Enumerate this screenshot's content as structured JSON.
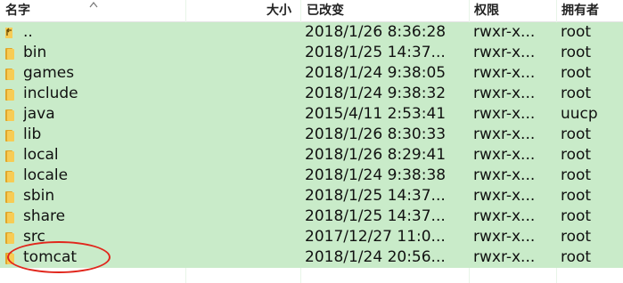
{
  "columns": {
    "name": "名字",
    "size": "大小",
    "modified": "已改变",
    "permissions": "权限",
    "owner": "拥有者"
  },
  "rows": [
    {
      "name": "..",
      "size": "",
      "modified": "2018/1/26 8:36:28",
      "permissions": "rwxr-x...",
      "owner": "root",
      "icon": "up-folder-icon"
    },
    {
      "name": "bin",
      "size": "",
      "modified": "2018/1/25 14:37...",
      "permissions": "rwxr-x...",
      "owner": "root",
      "icon": "folder-icon"
    },
    {
      "name": "games",
      "size": "",
      "modified": "2018/1/24 9:38:05",
      "permissions": "rwxr-x...",
      "owner": "root",
      "icon": "folder-icon"
    },
    {
      "name": "include",
      "size": "",
      "modified": "2018/1/24 9:38:32",
      "permissions": "rwxr-x...",
      "owner": "root",
      "icon": "folder-icon"
    },
    {
      "name": "java",
      "size": "",
      "modified": "2015/4/11 2:53:41",
      "permissions": "rwxr-x...",
      "owner": "uucp",
      "icon": "folder-icon"
    },
    {
      "name": "lib",
      "size": "",
      "modified": "2018/1/26 8:30:33",
      "permissions": "rwxr-x...",
      "owner": "root",
      "icon": "folder-icon"
    },
    {
      "name": "local",
      "size": "",
      "modified": "2018/1/26 8:29:41",
      "permissions": "rwxr-x...",
      "owner": "root",
      "icon": "folder-icon"
    },
    {
      "name": "locale",
      "size": "",
      "modified": "2018/1/24 9:38:38",
      "permissions": "rwxr-x...",
      "owner": "root",
      "icon": "folder-icon"
    },
    {
      "name": "sbin",
      "size": "",
      "modified": "2018/1/25 14:37...",
      "permissions": "rwxr-x...",
      "owner": "root",
      "icon": "folder-icon"
    },
    {
      "name": "share",
      "size": "",
      "modified": "2018/1/25 14:37...",
      "permissions": "rwxr-x...",
      "owner": "root",
      "icon": "folder-icon"
    },
    {
      "name": "src",
      "size": "",
      "modified": "2017/12/27 11:0...",
      "permissions": "rwxr-x...",
      "owner": "root",
      "icon": "folder-icon"
    },
    {
      "name": "tomcat",
      "size": "",
      "modified": "2018/1/24 20:56...",
      "permissions": "rwxr-x...",
      "owner": "root",
      "icon": "folder-icon"
    }
  ],
  "colors": {
    "row_background": "#c9ebc9",
    "folder": "#f7cc55",
    "annotation": "#e1261c"
  }
}
